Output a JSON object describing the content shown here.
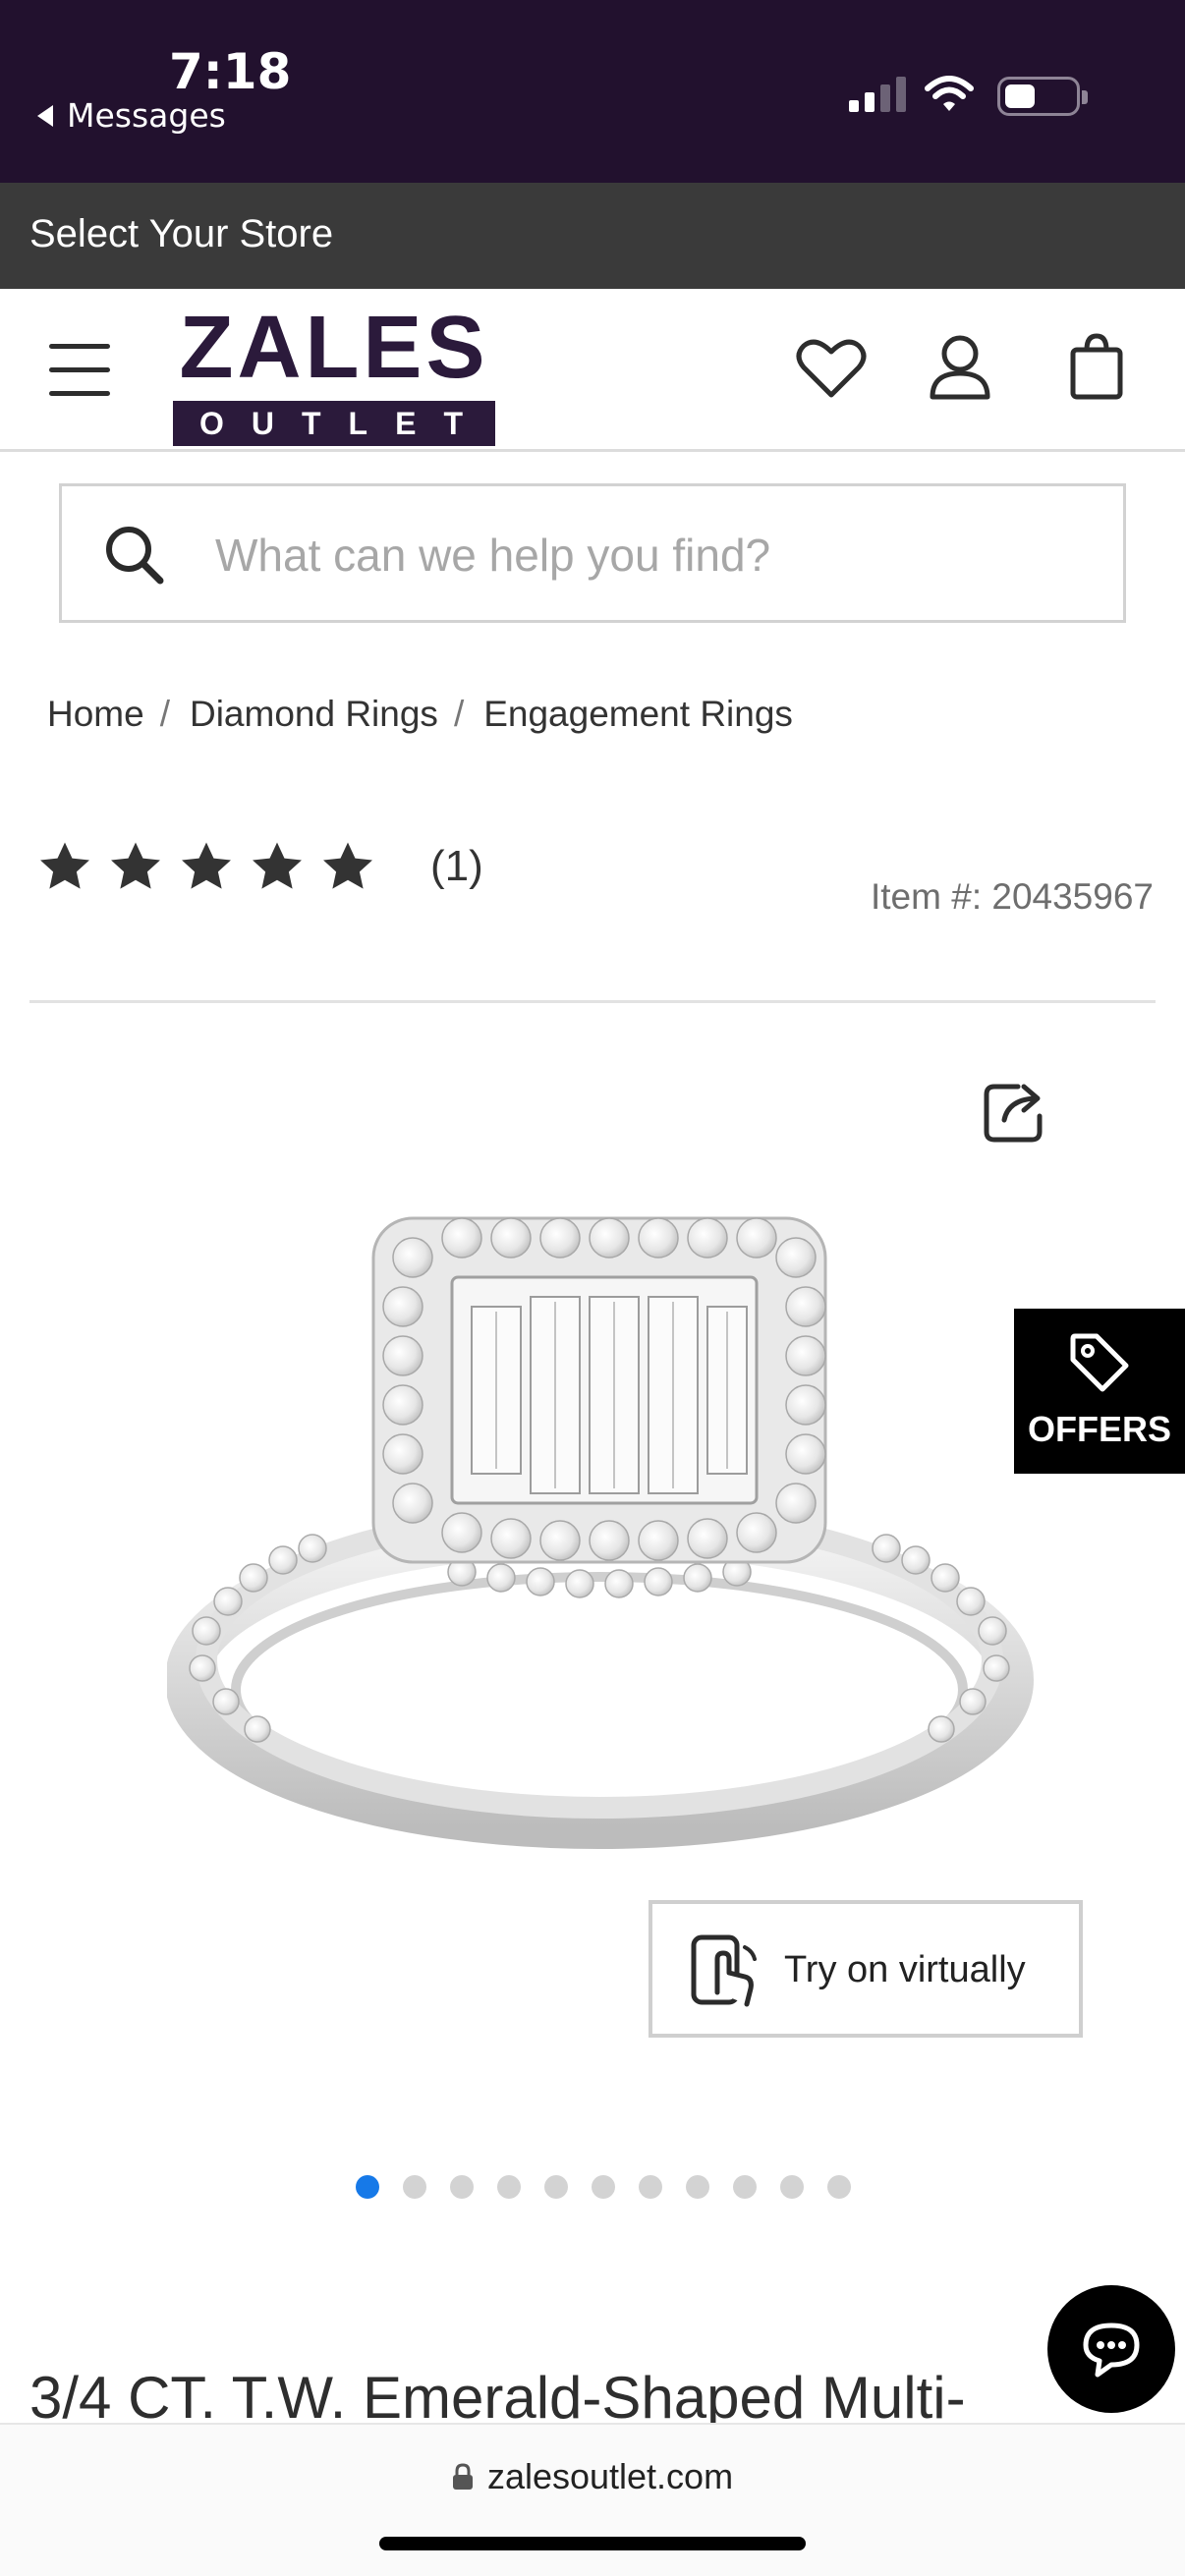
{
  "status_bar": {
    "time": "7:18",
    "back_label": "Messages"
  },
  "store_bar": {
    "label": "Select Your Store"
  },
  "header": {
    "logo_word": "ZALES",
    "logo_sub": "OUTLET",
    "icons": [
      "menu-icon",
      "heart-icon",
      "account-icon",
      "bag-icon"
    ]
  },
  "search": {
    "placeholder": "What can we help you find?"
  },
  "breadcrumb": {
    "items": [
      "Home",
      "Diamond Rings",
      "Engagement Rings"
    ],
    "separator": "/"
  },
  "rating": {
    "stars": 5,
    "count_label": "(1)"
  },
  "item_number": "Item #: 20435967",
  "offers": {
    "label": "OFFERS"
  },
  "try_on": {
    "label": "Try on virtually"
  },
  "carousel": {
    "total": 11,
    "active_index": 0
  },
  "product": {
    "title": "3/4 CT. T.W. Emerald-Shaped Multi-"
  },
  "browser": {
    "url": "zalesoutlet.com"
  },
  "colors": {
    "brand_purple": "#2b1a3b",
    "status_bar": "#22112e",
    "store_bar": "#3a3a3a",
    "active_dot": "#1679e8"
  }
}
